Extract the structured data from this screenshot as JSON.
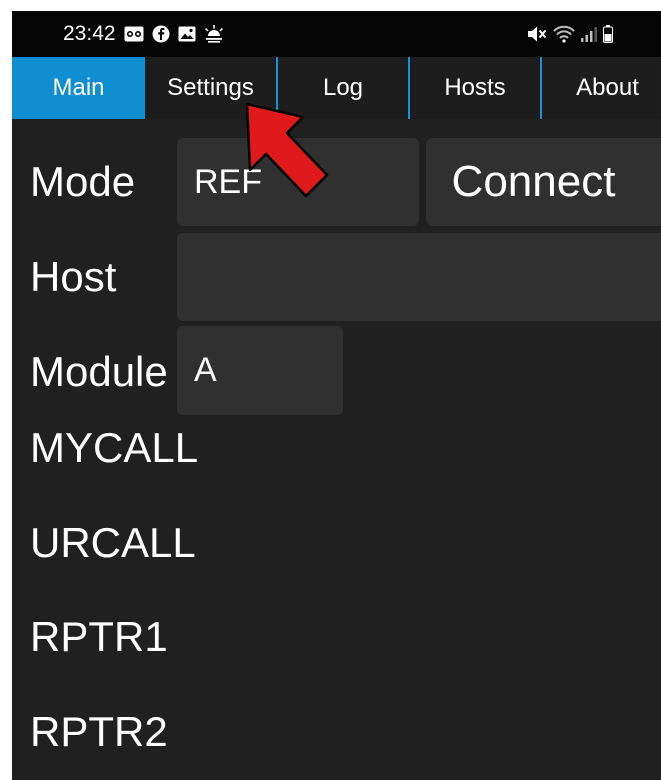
{
  "status_bar": {
    "time": "23:42",
    "left_icons": [
      "voicemail-icon",
      "facebook-icon",
      "gallery-icon",
      "weather-icon"
    ],
    "right_icons": [
      "mute-icon",
      "wifi-icon",
      "signal-icon",
      "battery-icon"
    ]
  },
  "tabs": [
    {
      "label": "Main",
      "active": true
    },
    {
      "label": "Settings",
      "active": false
    },
    {
      "label": "Log",
      "active": false
    },
    {
      "label": "Hosts",
      "active": false
    },
    {
      "label": "About",
      "active": false
    }
  ],
  "main": {
    "mode_label": "Mode",
    "mode_value": "REF",
    "connect_label": "Connect",
    "host_label": "Host",
    "host_value": "",
    "module_label": "Module",
    "module_value": "A",
    "mycall_label": "MYCALL",
    "urcall_label": "URCALL",
    "rptr1_label": "RPTR1",
    "rptr2_label": "RPTR2"
  },
  "annotation": {
    "arrow_color": "#e01a1a",
    "arrow_target": "Settings"
  },
  "colors": {
    "accent": "#0f8ed1",
    "background": "#202020",
    "field": "#303030"
  }
}
